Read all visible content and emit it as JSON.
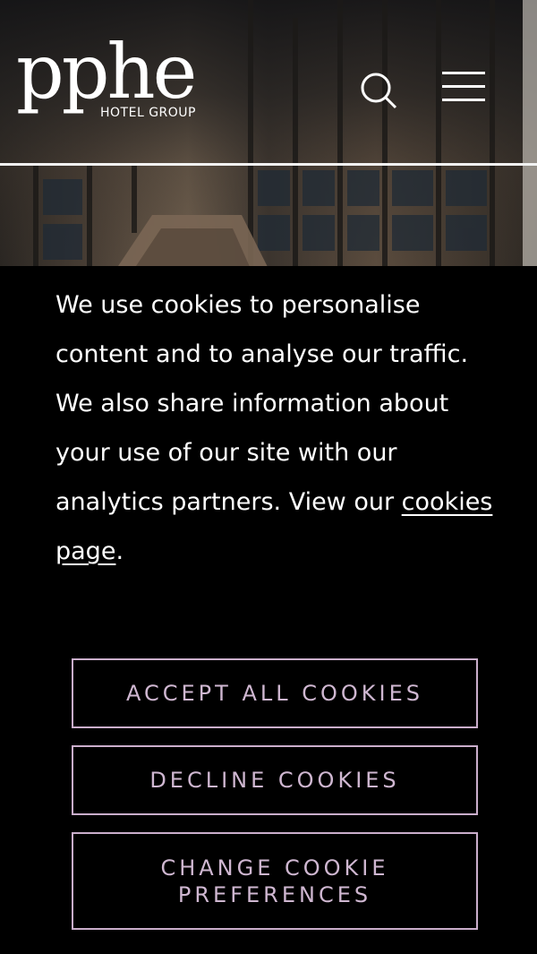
{
  "header": {
    "logo_word": "pphe",
    "logo_subtitle": "HOTEL GROUP",
    "search_icon": "search-icon",
    "menu_icon": "hamburger-menu-icon"
  },
  "cookie_banner": {
    "message": "We use cookies to personalise content and to analyse our traffic. We also share information about your use of our site with our analytics partners. View our ",
    "link_text": "cookies page",
    "message_end": ".",
    "accept_label": "ACCEPT ALL COOKIES",
    "decline_label": "DECLINE COOKIES",
    "change_label": "CHANGE COOKIE PREFERENCES"
  },
  "colors": {
    "banner_bg": "#000000",
    "button_border": "#caaecb",
    "button_text": "#cfb7d1",
    "text": "#ffffff"
  }
}
